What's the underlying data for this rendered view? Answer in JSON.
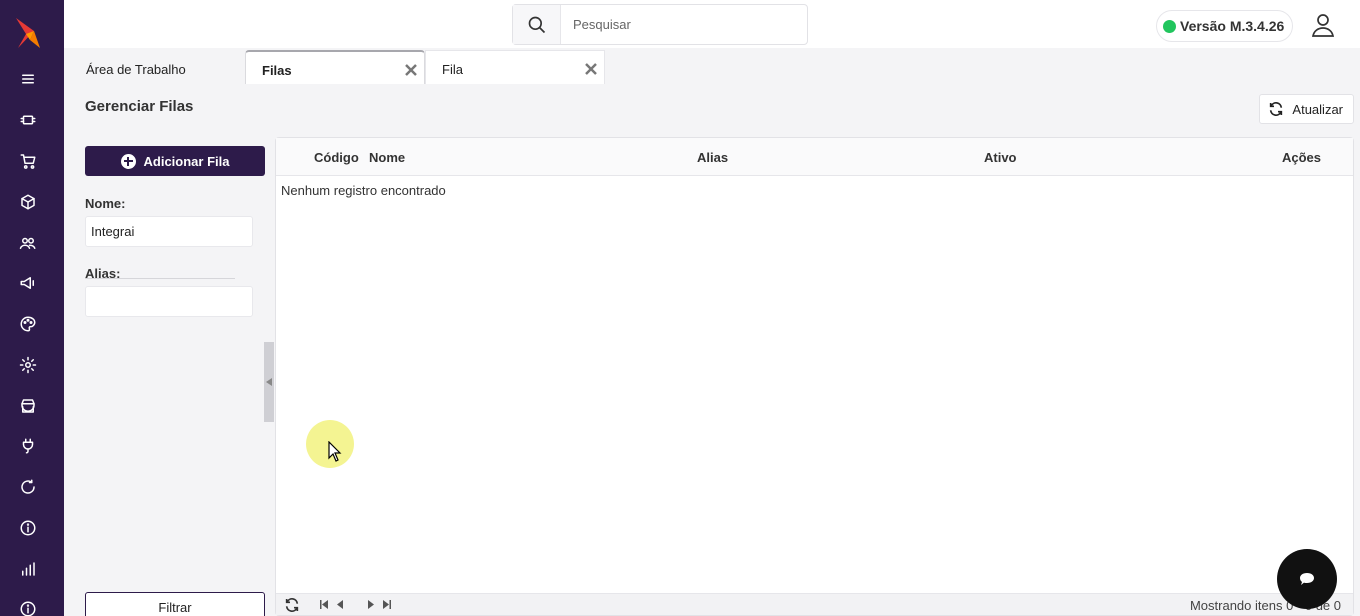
{
  "app": {
    "brand_color": "#2d1b4a",
    "logo_colors": [
      "#e53935",
      "#f57c00"
    ]
  },
  "sidebar": {
    "items": [
      {
        "icon": "menu-icon"
      },
      {
        "icon": "plug-icon"
      },
      {
        "icon": "cart-icon"
      },
      {
        "icon": "box-icon"
      },
      {
        "icon": "users-icon"
      },
      {
        "icon": "megaphone-icon"
      },
      {
        "icon": "palette-icon"
      },
      {
        "icon": "gear-icon"
      },
      {
        "icon": "store-icon"
      },
      {
        "icon": "power-plug-icon"
      },
      {
        "icon": "refresh-icon"
      },
      {
        "icon": "info-icon"
      },
      {
        "icon": "bar-chart-icon"
      },
      {
        "icon": "info-icon"
      }
    ]
  },
  "header": {
    "search_placeholder": "Pesquisar",
    "version_label": "Versão M.3.4.26",
    "version_status_color": "#21c55d"
  },
  "tabs": [
    {
      "label": "Área de Trabalho",
      "closable": false
    },
    {
      "label": "Filas",
      "closable": true,
      "active": true
    },
    {
      "label": "Fila",
      "closable": true
    }
  ],
  "page": {
    "title": "Gerenciar Filas",
    "refresh_label": "Atualizar"
  },
  "filter": {
    "add_label": "Adicionar Fila",
    "name_label": "Nome:",
    "name_value": "Integrai",
    "alias_label": "Alias:",
    "alias_value": "",
    "filter_label": "Filtrar"
  },
  "grid": {
    "columns": [
      "Código",
      "Nome",
      "Alias",
      "Ativo",
      "Ações"
    ],
    "empty_message": "Nenhum registro encontrado",
    "pager_info": "Mostrando itens 0 - 0 de 0"
  }
}
